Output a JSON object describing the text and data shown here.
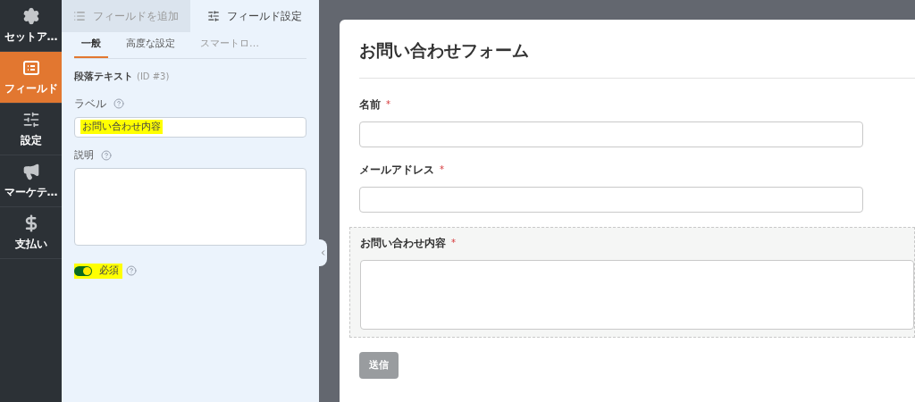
{
  "sidebar": {
    "items": [
      {
        "label": "セットア…",
        "kind": "gear",
        "selected": false
      },
      {
        "label": "フィールド",
        "kind": "fields",
        "selected": true
      },
      {
        "label": "設定",
        "kind": "sliders",
        "selected": false
      },
      {
        "label": "マーケテ…",
        "kind": "megaphone",
        "selected": false
      },
      {
        "label": "支払い",
        "kind": "dollar",
        "selected": false
      }
    ]
  },
  "panel": {
    "tabs": [
      {
        "label": "フィールドを追加",
        "kind": "list",
        "selected": false
      },
      {
        "label": "フィールド設定",
        "kind": "sliders",
        "selected": true
      }
    ],
    "subtabs": [
      {
        "label": "一般",
        "selected": true
      },
      {
        "label": "高度な設定",
        "selected": false
      },
      {
        "label": "スマートロ…",
        "selected": false
      }
    ],
    "field_title": "段落テキスト",
    "field_id": "(ID #3)",
    "label_field": {
      "label": "ラベル",
      "value": "お問い合わせ内容",
      "highlighted": true
    },
    "description_field": {
      "label": "説明"
    },
    "required_toggle": {
      "label": "必須",
      "on": true,
      "highlighted": true
    }
  },
  "form": {
    "title": "お問い合わせフォーム",
    "fields": [
      {
        "label": "名前",
        "kind": "text",
        "required": true,
        "selected": false
      },
      {
        "label": "メールアドレス",
        "kind": "text",
        "required": true,
        "selected": false
      },
      {
        "label": "お問い合わせ内容",
        "kind": "textarea",
        "required": true,
        "selected": true
      }
    ],
    "required_mark": "*",
    "submit": "送信"
  }
}
